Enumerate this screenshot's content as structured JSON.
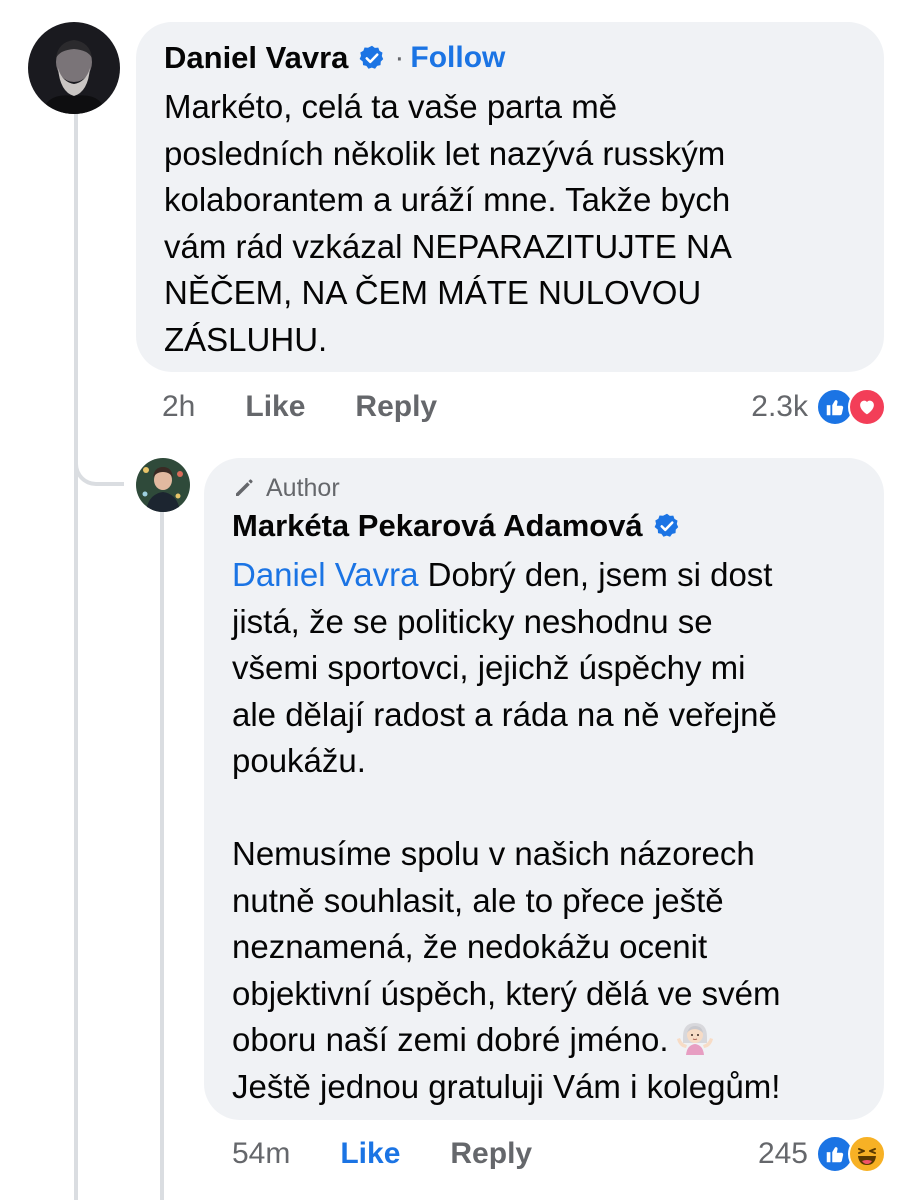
{
  "comment": {
    "author": "Daniel Vavra",
    "separator": "·",
    "follow_label": "Follow",
    "lines": [
      "Markéto, celá ta vaše parta mě",
      "posledních několik let nazývá rusským",
      "kolaborantem a uráží mne. Takže bych",
      "vám rád vzkázal NEPARAZITUJTE NA",
      "NĚČEM, NA ČEM MÁTE NULOVOU",
      "ZÁSLUHU."
    ],
    "time": "2h",
    "like_label": "Like",
    "reply_label": "Reply",
    "reaction_count": "2.3k",
    "reaction_icons": [
      "like-reaction-icon",
      "love-reaction-icon"
    ]
  },
  "reply": {
    "badge_label": "Author",
    "author": "Markéta Pekarová Adamová",
    "mention": "Daniel Vavra",
    "lines_p1": [
      " Dobrý den, jsem si dost",
      "jistá, že se politicky neshodnu se",
      "všemi sportovci, jejichž úspěchy mi",
      "ale dělají radost a ráda na ně veřejně",
      "poukážu."
    ],
    "lines_p2": [
      "Nemusíme spolu v našich názorech",
      "nutně souhlasit, ale to přece ještě",
      "neznamená, že nedokážu ocenit",
      "objektivní úspěch, který dělá ve svém",
      "oboru naší zemi dobré jméno.",
      "Ještě jednou gratuluji Vám i kolegům!"
    ],
    "emoji": "shrugging-woman-emoji",
    "time": "54m",
    "like_label": "Like",
    "reply_label": "Reply",
    "reaction_count": "245",
    "reaction_icons": [
      "like-reaction-icon",
      "haha-reaction-icon"
    ]
  },
  "colors": {
    "link_blue": "#1b74e4",
    "bubble_bg": "#f0f2f5",
    "meta_gray": "#65676b",
    "love_red": "#f33e58",
    "haha_yellow": "#f7b125"
  }
}
